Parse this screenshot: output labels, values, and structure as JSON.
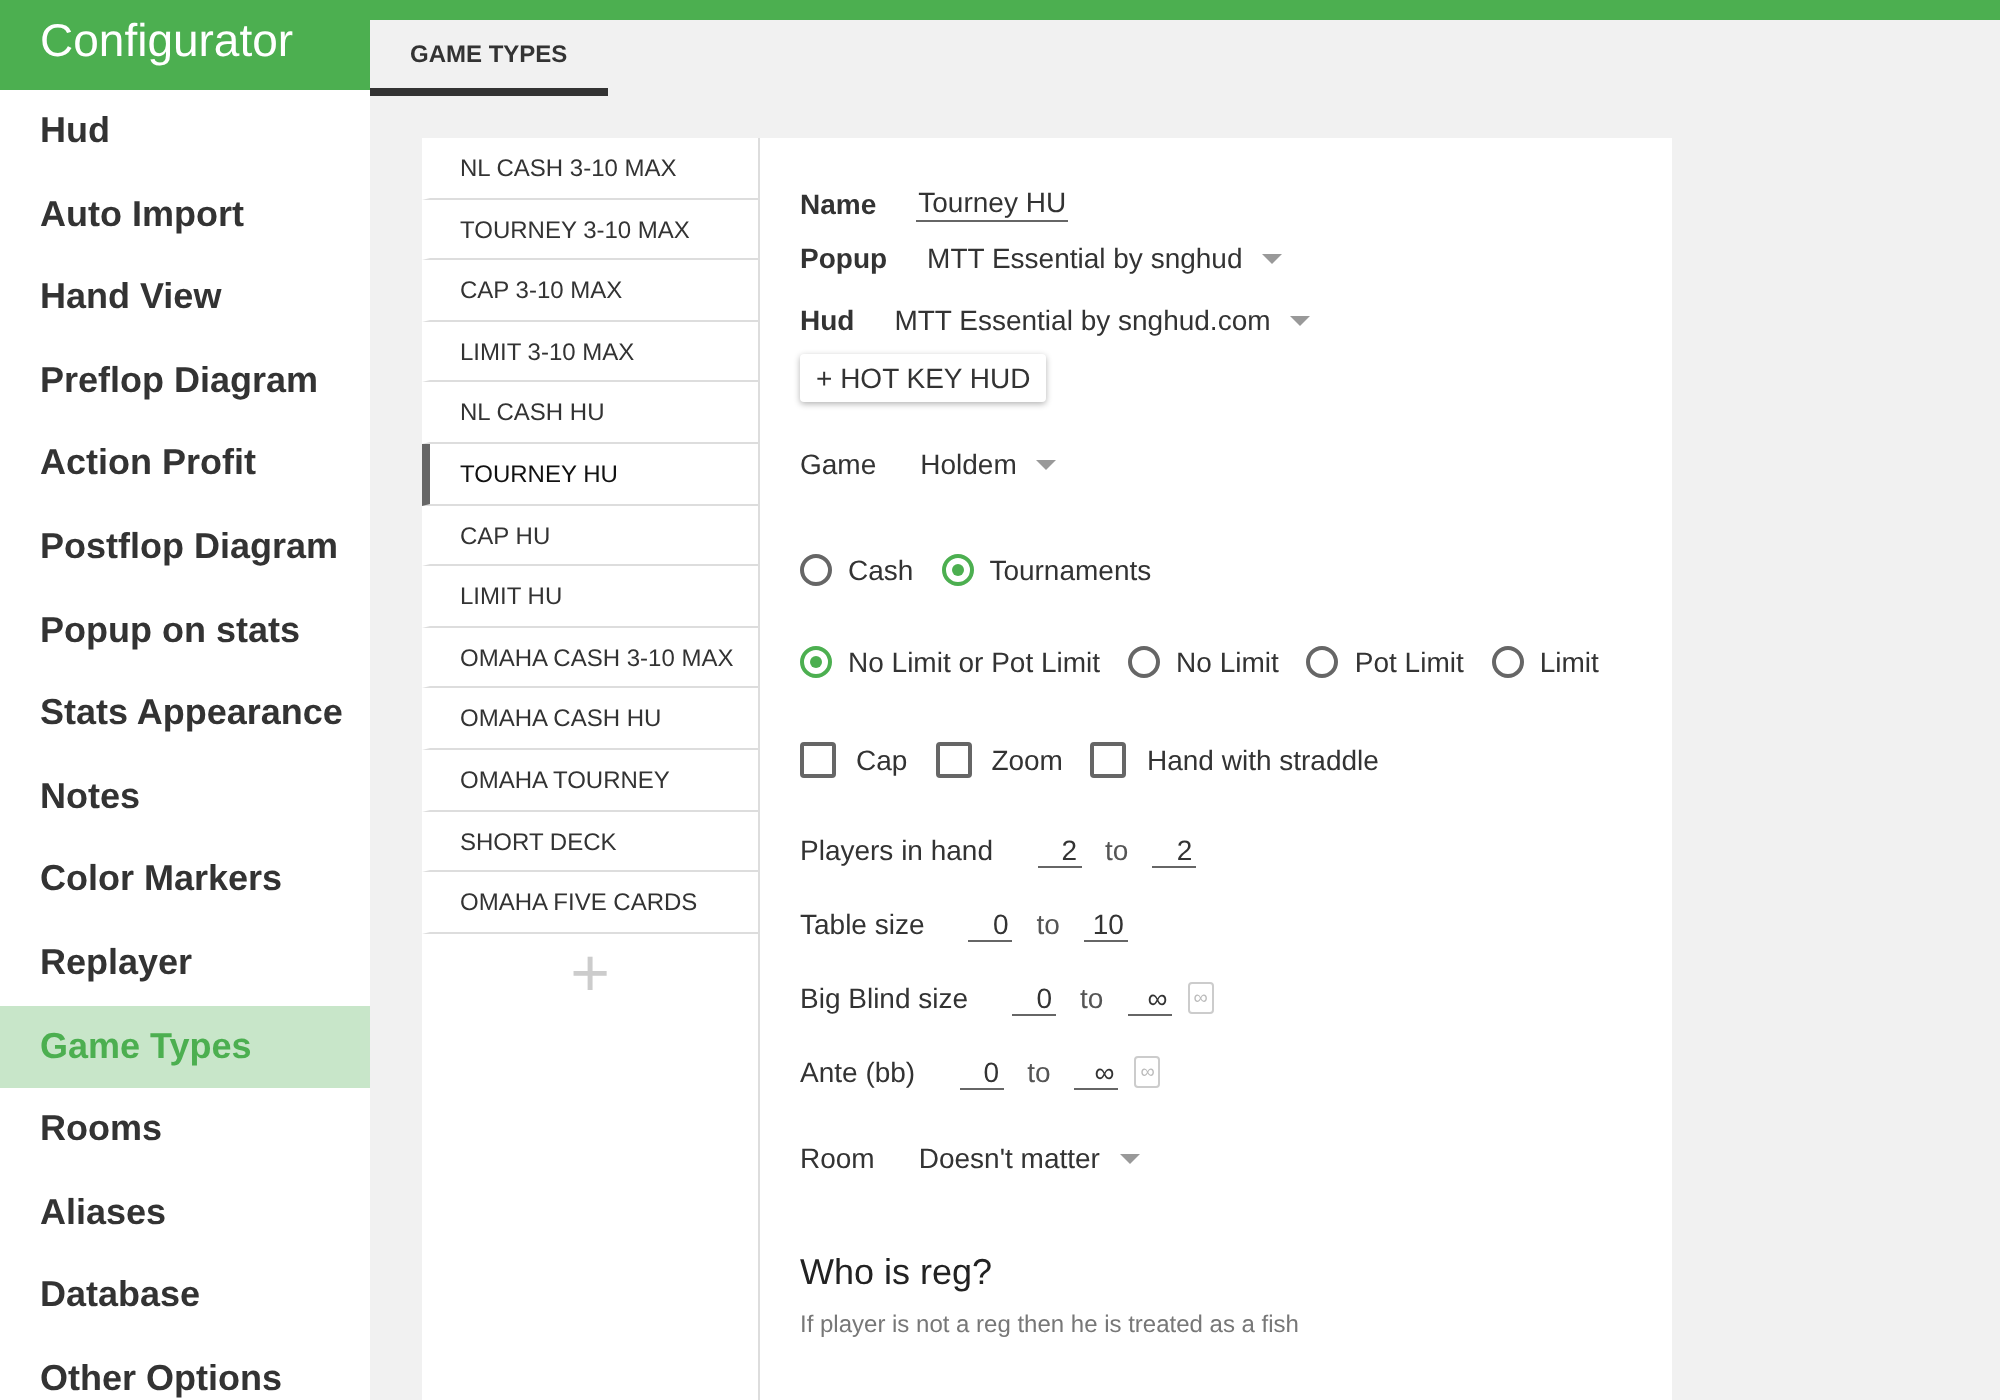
{
  "app_title": "Configurator",
  "nav": [
    {
      "label": "Hud",
      "selected": false
    },
    {
      "label": "Auto Import",
      "selected": false
    },
    {
      "label": "Hand View",
      "selected": false
    },
    {
      "label": "Preflop Diagram",
      "selected": false
    },
    {
      "label": "Action Profit",
      "selected": false
    },
    {
      "label": "Postflop Diagram",
      "selected": false
    },
    {
      "label": "Popup on stats",
      "selected": false
    },
    {
      "label": "Stats Appearance",
      "selected": false
    },
    {
      "label": "Notes",
      "selected": false
    },
    {
      "label": "Color Markers",
      "selected": false
    },
    {
      "label": "Replayer",
      "selected": false
    },
    {
      "label": "Game Types",
      "selected": true
    },
    {
      "label": "Rooms",
      "selected": false
    },
    {
      "label": "Aliases",
      "selected": false
    },
    {
      "label": "Database",
      "selected": false
    },
    {
      "label": "Other Options",
      "selected": false
    }
  ],
  "tabs": [
    {
      "label": "GAME TYPES",
      "selected": true
    }
  ],
  "game_types": [
    {
      "label": "NL CASH 3-10 MAX",
      "selected": false
    },
    {
      "label": "TOURNEY 3-10 MAX",
      "selected": false
    },
    {
      "label": "CAP 3-10 MAX",
      "selected": false
    },
    {
      "label": "LIMIT 3-10 MAX",
      "selected": false
    },
    {
      "label": "NL CASH HU",
      "selected": false
    },
    {
      "label": "TOURNEY HU",
      "selected": true
    },
    {
      "label": "CAP HU",
      "selected": false
    },
    {
      "label": "LIMIT HU",
      "selected": false
    },
    {
      "label": "OMAHA CASH 3-10 MAX",
      "selected": false
    },
    {
      "label": "OMAHA CASH HU",
      "selected": false
    },
    {
      "label": "OMAHA TOURNEY",
      "selected": false
    },
    {
      "label": "SHORT DECK",
      "selected": false
    },
    {
      "label": "OMAHA FIVE CARDS",
      "selected": false
    }
  ],
  "add_button": "+",
  "form": {
    "name": {
      "label": "Name",
      "value": "Tourney HU"
    },
    "popup": {
      "label": "Popup",
      "value": "MTT Essential by snghud"
    },
    "hud": {
      "label": "Hud",
      "value": "MTT Essential by snghud.com"
    },
    "hot_key_button": "+ HOT KEY HUD",
    "game": {
      "label": "Game",
      "value": "Holdem"
    },
    "type_radios": [
      {
        "label": "Cash",
        "selected": false
      },
      {
        "label": "Tournaments",
        "selected": true
      }
    ],
    "limit_radios": [
      {
        "label": "No Limit or Pot Limit",
        "selected": true
      },
      {
        "label": "No Limit",
        "selected": false
      },
      {
        "label": "Pot Limit",
        "selected": false
      },
      {
        "label": "Limit",
        "selected": false
      }
    ],
    "checkboxes": [
      {
        "label": "Cap",
        "checked": false
      },
      {
        "label": "Zoom",
        "checked": false
      },
      {
        "label": "Hand with straddle",
        "checked": false
      }
    ],
    "ranges": [
      {
        "label": "Players in hand",
        "from": "2",
        "sep": "to",
        "to": "2"
      },
      {
        "label": "Table size",
        "from": "0",
        "sep": "to",
        "to": "10"
      },
      {
        "label": "Big Blind size",
        "from": "0",
        "sep": "to",
        "to": "∞",
        "infinity_button": "∞"
      },
      {
        "label": "Ante (bb)",
        "from": "0",
        "sep": "to",
        "to": "∞",
        "infinity_button": "∞"
      }
    ],
    "room": {
      "label": "Room",
      "value": "Doesn't matter"
    },
    "section_title": "Who is reg?",
    "section_hint": "If player is not a reg then he is treated as a fish"
  }
}
